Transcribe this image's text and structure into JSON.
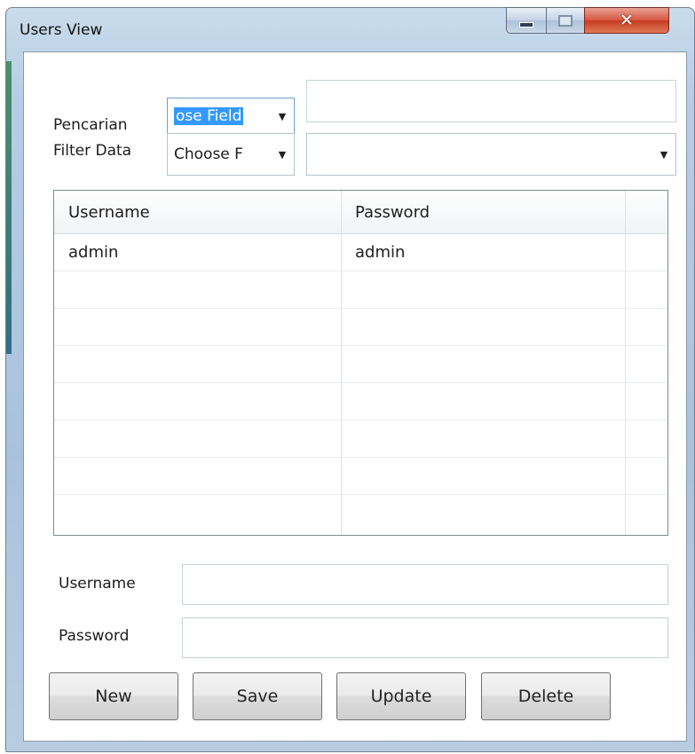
{
  "window": {
    "title": "Users View"
  },
  "search": {
    "label": "Pencarian",
    "field_value": "ose Field",
    "text_value": ""
  },
  "filter": {
    "label": "Filter Data",
    "field_value": "Choose F",
    "value": ""
  },
  "grid": {
    "columns": [
      "Username",
      "Password"
    ],
    "rows": [
      [
        "admin",
        "admin"
      ]
    ]
  },
  "form": {
    "username_label": "Username",
    "username_value": "",
    "password_label": "Password",
    "password_value": ""
  },
  "buttons": {
    "new": "New",
    "save": "Save",
    "update": "Update",
    "delete": "Delete"
  },
  "icons": {
    "minimize": "minimize-icon",
    "maximize": "maximize-icon",
    "close": "close-icon",
    "dropdown": "chevron-down-icon"
  }
}
